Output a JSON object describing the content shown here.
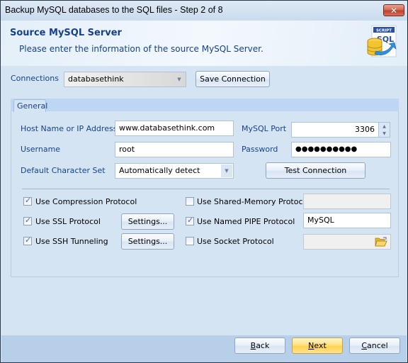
{
  "window": {
    "title": "Backup MySQL databases to the SQL files - Step 2 of 8",
    "close_icon": "close-icon"
  },
  "header": {
    "title": "Source MySQL Server",
    "subtitle": "Please enter the information of the source MySQL Server.",
    "icon": "script-sql-database-icon",
    "icon_badge": "SCRIPT",
    "icon_text": "SQL"
  },
  "connections": {
    "label": "Connections",
    "value": "databasethink",
    "save_button": "Save Connection"
  },
  "tabs": [
    {
      "label": "General",
      "active": true
    }
  ],
  "general": {
    "host_label": "Host Name or IP Address",
    "host_value": "www.databasethink.com",
    "port_label": "MySQL Port",
    "port_value": "3306",
    "username_label": "Username",
    "username_value": "root",
    "password_label": "Password",
    "password_value": "●●●●●●●●●●",
    "charset_label": "Default Character Set",
    "charset_value": "Automatically detect",
    "test_button": "Test Connection"
  },
  "options": {
    "compression": {
      "label": "Use Compression Protocol",
      "checked": true
    },
    "ssl": {
      "label": "Use SSL Protocol",
      "checked": true,
      "settings_button": "Settings..."
    },
    "ssh": {
      "label": "Use SSH Tunneling",
      "checked": true,
      "settings_button": "Settings..."
    },
    "shared_memory": {
      "label": "Use Shared-Memory Protocol",
      "checked": false,
      "value": ""
    },
    "named_pipe": {
      "label": "Use Named PIPE Protocol",
      "checked": true,
      "value": "MySQL"
    },
    "socket": {
      "label": "Use Socket Protocol",
      "checked": false,
      "value": ""
    }
  },
  "footer": {
    "back": {
      "label": "Back",
      "mnemonic": "B",
      "rest": "ack"
    },
    "next": {
      "label": "Next",
      "mnemonic": "N",
      "rest": "ext"
    },
    "cancel": {
      "label": "Cancel",
      "mnemonic": "C",
      "rest": "ancel"
    }
  }
}
